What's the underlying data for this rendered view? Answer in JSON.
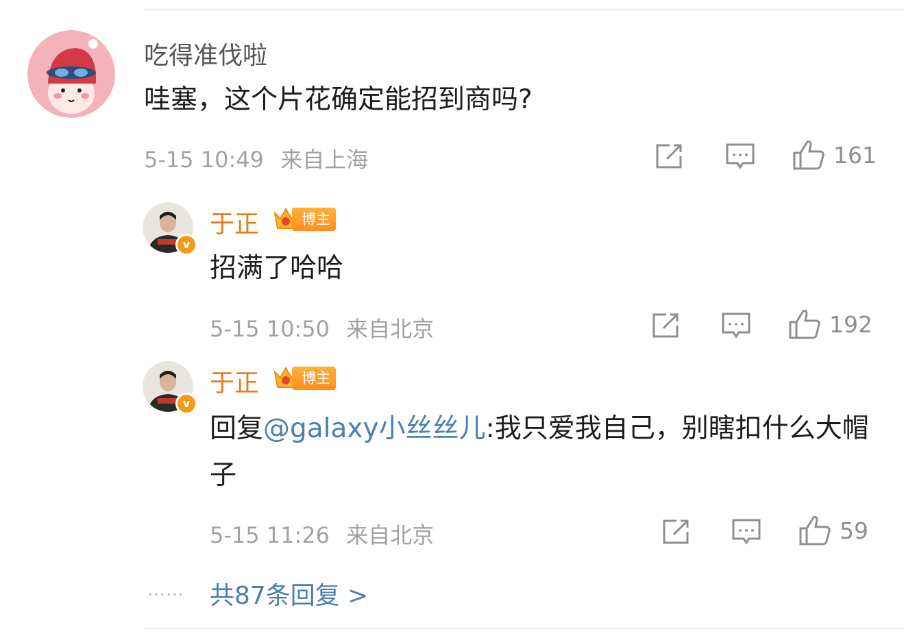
{
  "comment": {
    "username": "吃得准伐啦",
    "text": "哇塞，这个片花确定能招到商吗?",
    "time": "5-15 10:49",
    "location": "来自上海",
    "like_count": "161"
  },
  "replies": [
    {
      "username": "于正",
      "badge": "博主",
      "text": "招满了哈哈",
      "time": "5-15 10:50",
      "location": "来自北京",
      "like_count": "192"
    },
    {
      "username": "于正",
      "badge": "博主",
      "reply_prefix": "回复",
      "mention": "@galaxy小丝丝儿",
      "text": ":我只爱我自己，别瞎扣什么大帽子",
      "time": "5-15 11:26",
      "location": "来自北京",
      "like_count": "59"
    }
  ],
  "more_replies": {
    "dots": "……",
    "label": "共87条回复 >"
  },
  "colors": {
    "blogger_name": "#ee7a16",
    "mention": "#4a7fb0",
    "meta": "#a2a2a2",
    "badge": "#ff9d2a"
  }
}
